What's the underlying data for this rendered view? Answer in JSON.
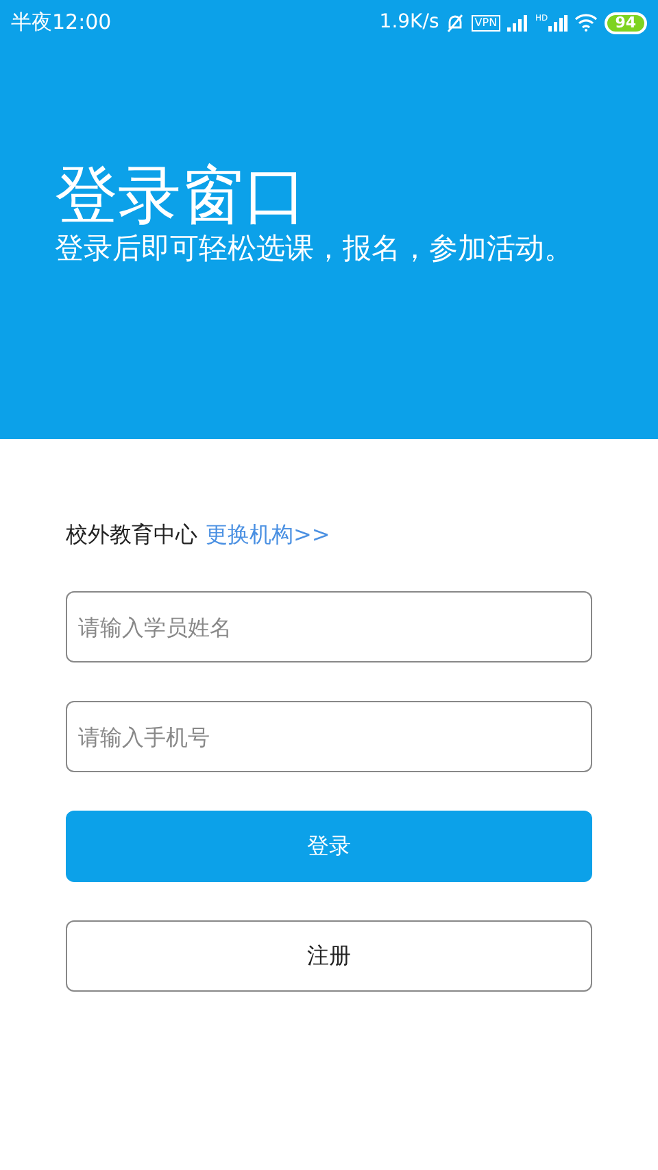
{
  "status_bar": {
    "time": "半夜12:00",
    "speed": "1.9K/s",
    "vpn": "VPN",
    "signal_label": "HD",
    "battery": "94"
  },
  "header": {
    "title": "登录窗口",
    "subtitle": "登录后即可轻松选课，报名，参加活动。"
  },
  "org": {
    "name": "校外教育中心",
    "link": "更换机构>>"
  },
  "fields": [
    {
      "placeholder": "请输入学员姓名"
    },
    {
      "placeholder": "请输入手机号"
    }
  ],
  "buttons": [
    {
      "label": "登录",
      "kind": "primary"
    },
    {
      "label": "注册",
      "kind": "outline"
    }
  ]
}
